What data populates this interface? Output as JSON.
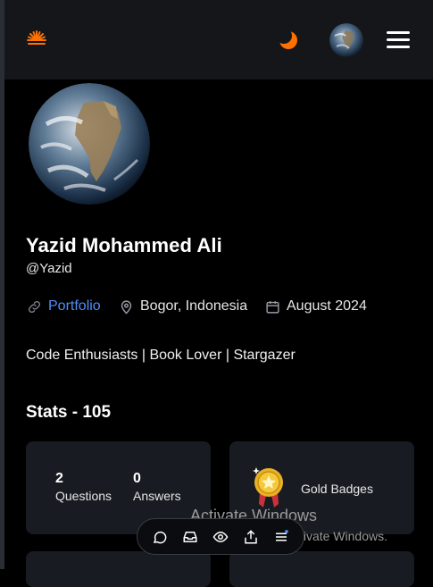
{
  "profile": {
    "name": "Yazid Mohammed Ali",
    "handle": "@Yazid",
    "portfolio_label": "Portfolio",
    "location": "Bogor, Indonesia",
    "joined": "August 2024",
    "bio": "Code Enthusiasts | Book Lover | Stargazer"
  },
  "stats": {
    "title": "Stats - 105",
    "questions_count": "2",
    "questions_label": "Questions",
    "answers_count": "0",
    "answers_label": "Answers",
    "badge_label": "Gold Badges"
  },
  "watermark": {
    "title": "Activate Windows",
    "subtitle": "Go to Settings to activate Windows."
  },
  "colors": {
    "background": "#000000",
    "topbar": "#14161a",
    "card": "#181b21",
    "accent_orange": "#ff7000",
    "link_blue": "#4f8ff7"
  },
  "icons": {
    "logo": "sun-burst-logo",
    "theme": "moon-icon",
    "menu": "hamburger-icon",
    "portfolio": "link-icon",
    "location": "map-pin-icon",
    "joined": "calendar-icon",
    "badge": "gold-medal-icon",
    "dock": [
      "chat-icon",
      "inbox-icon",
      "eye-icon",
      "share-icon",
      "list-icon"
    ]
  }
}
